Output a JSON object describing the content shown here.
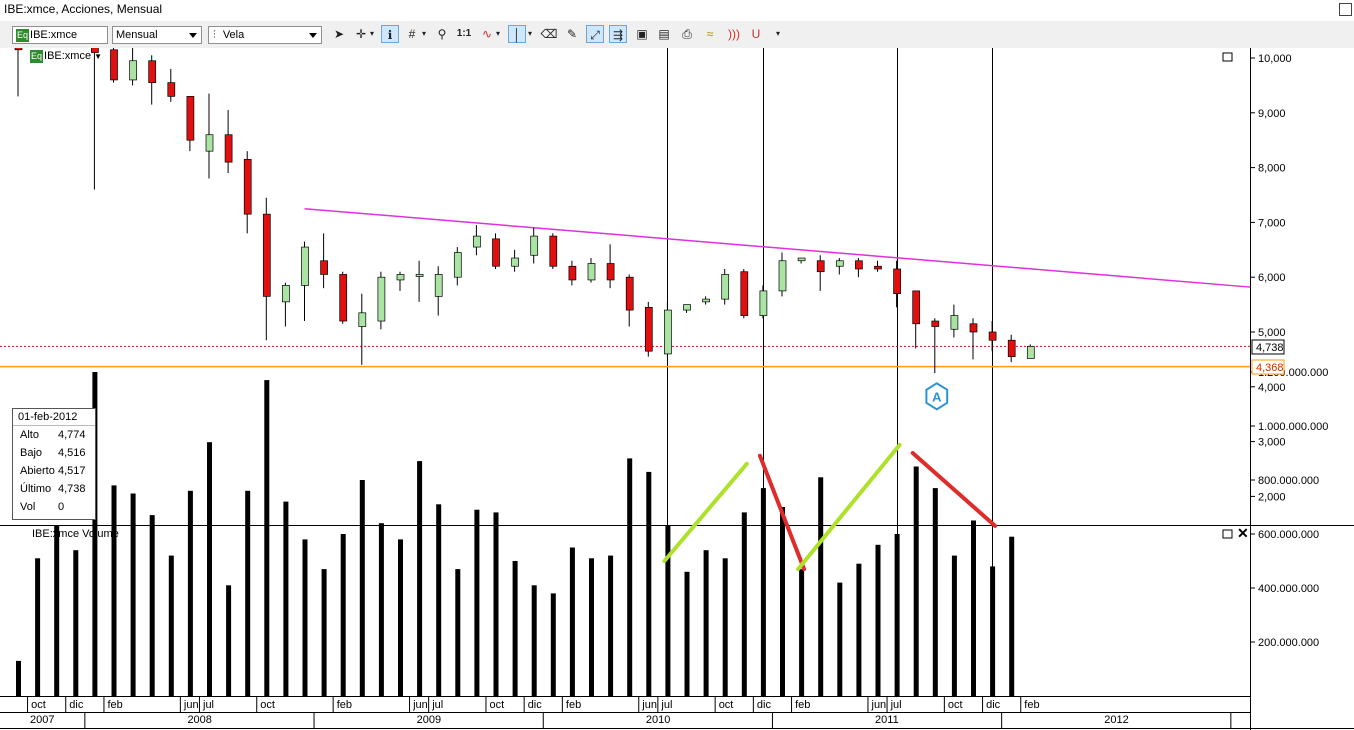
{
  "window": {
    "title": "IBE:xmce, Acciones, Mensual"
  },
  "toolbar": {
    "symbol": "IBE:xmce",
    "symbol_badge": "Eq",
    "period": "Mensual",
    "chart_type": "Vela",
    "zoom_1to1": "1:1"
  },
  "price_panel": {
    "symbol_label": "IBE:xmce",
    "symbol_badge": "Eq",
    "y_ticks": [
      "10,000",
      "9,000",
      "8,000",
      "7,000",
      "6,000",
      "5,000",
      "4,000",
      "3,000",
      "2,000"
    ],
    "current_price_label": "4,738",
    "support_label": "4,368",
    "marker_label": "A"
  },
  "info_box": {
    "date": "01-feb-2012",
    "rows": [
      {
        "label": "Alto",
        "value": "4,774"
      },
      {
        "label": "Bajo",
        "value": "4,516"
      },
      {
        "label": "Abierto",
        "value": "4,517"
      },
      {
        "label": "Último",
        "value": "4,738"
      },
      {
        "label": "Vol",
        "value": "0"
      }
    ]
  },
  "volume_panel": {
    "title": "IBE:xmce Volume",
    "y_ticks": [
      "1.200.000.000",
      "1.000.000.000",
      "800.000.000",
      "600.000.000",
      "400.000.000",
      "200.000.000"
    ]
  },
  "x_axis": {
    "months": [
      "oct",
      "dic",
      "feb",
      "jun",
      "jul",
      "oct",
      "feb",
      "jun",
      "jul",
      "oct",
      "dic",
      "feb",
      "jun",
      "jul",
      "oct",
      "dic",
      "feb",
      "jun",
      "jul",
      "oct",
      "dic",
      "feb"
    ],
    "years": [
      "2007",
      "2008",
      "2009",
      "2010",
      "2011",
      "2012"
    ]
  },
  "colors": {
    "up": "#a9e4a3",
    "down": "#e01010",
    "trendline": "#e030e0",
    "support": "#ff9a1a",
    "current_price": "#e01010",
    "volume_up_trend": "#aee22a",
    "volume_down_trend": "#e02b2b",
    "marker": "#2a93d8"
  },
  "chart_data": {
    "type": "candlestick",
    "period": "monthly",
    "ylim": [
      1500,
      10200
    ],
    "candles": [
      {
        "month": "2007-09",
        "open": 10200,
        "high": 10200,
        "low": 9300,
        "close": 10150
      },
      {
        "month": "2008-01",
        "open": 10200,
        "high": 10200,
        "low": 7600,
        "close": 10100
      },
      {
        "month": "2008-02",
        "open": 10150,
        "high": 10200,
        "low": 9550,
        "close": 9600
      },
      {
        "month": "2008-03",
        "open": 9600,
        "high": 10200,
        "low": 9500,
        "close": 9950
      },
      {
        "month": "2008-04",
        "open": 9950,
        "high": 10050,
        "low": 9150,
        "close": 9550
      },
      {
        "month": "2008-05",
        "open": 9550,
        "high": 9800,
        "low": 9200,
        "close": 9300
      },
      {
        "month": "2008-06",
        "open": 9300,
        "high": 9300,
        "low": 8300,
        "close": 8500
      },
      {
        "month": "2008-07",
        "open": 8300,
        "high": 9350,
        "low": 7800,
        "close": 8600
      },
      {
        "month": "2008-08",
        "open": 8600,
        "high": 9050,
        "low": 7900,
        "close": 8100
      },
      {
        "month": "2008-09",
        "open": 8150,
        "high": 8300,
        "low": 6800,
        "close": 7150
      },
      {
        "month": "2008-10",
        "open": 7150,
        "high": 7450,
        "low": 4850,
        "close": 5650
      },
      {
        "month": "2008-11",
        "open": 5550,
        "high": 5900,
        "low": 5100,
        "close": 5850
      },
      {
        "month": "2008-12",
        "open": 5850,
        "high": 6650,
        "low": 5200,
        "close": 6550
      },
      {
        "month": "2009-01",
        "open": 6300,
        "high": 6800,
        "low": 5800,
        "close": 6050
      },
      {
        "month": "2009-02",
        "open": 6050,
        "high": 6100,
        "low": 5150,
        "close": 5200
      },
      {
        "month": "2009-03",
        "open": 5100,
        "high": 5700,
        "low": 4400,
        "close": 5350
      },
      {
        "month": "2009-04",
        "open": 5200,
        "high": 6100,
        "low": 5050,
        "close": 6000
      },
      {
        "month": "2009-05",
        "open": 5950,
        "high": 6100,
        "low": 5750,
        "close": 6050
      },
      {
        "month": "2009-06",
        "open": 6050,
        "high": 6300,
        "low": 5550,
        "close": 6050
      },
      {
        "month": "2009-07",
        "open": 5650,
        "high": 6200,
        "low": 5300,
        "close": 6050
      },
      {
        "month": "2009-08",
        "open": 6000,
        "high": 6550,
        "low": 5850,
        "close": 6450
      },
      {
        "month": "2009-09",
        "open": 6550,
        "high": 6950,
        "low": 6400,
        "close": 6750
      },
      {
        "month": "2009-10",
        "open": 6700,
        "high": 6800,
        "low": 6150,
        "close": 6200
      },
      {
        "month": "2009-11",
        "open": 6200,
        "high": 6500,
        "low": 6100,
        "close": 6350
      },
      {
        "month": "2009-12",
        "open": 6400,
        "high": 6900,
        "low": 6250,
        "close": 6750
      },
      {
        "month": "2010-01",
        "open": 6750,
        "high": 6800,
        "low": 6150,
        "close": 6200
      },
      {
        "month": "2010-02",
        "open": 6200,
        "high": 6300,
        "low": 5850,
        "close": 5950
      },
      {
        "month": "2010-03",
        "open": 5950,
        "high": 6350,
        "low": 5900,
        "close": 6250
      },
      {
        "month": "2010-04",
        "open": 6250,
        "high": 6600,
        "low": 5800,
        "close": 5950
      },
      {
        "month": "2010-05",
        "open": 6000,
        "high": 6050,
        "low": 5100,
        "close": 5400
      },
      {
        "month": "2010-06",
        "open": 5450,
        "high": 5550,
        "low": 4550,
        "close": 4650
      },
      {
        "month": "2010-07",
        "open": 4600,
        "high": 5550,
        "low": 4550,
        "close": 5400
      },
      {
        "month": "2010-08",
        "open": 5400,
        "high": 5500,
        "low": 5350,
        "close": 5500
      },
      {
        "month": "2010-09",
        "open": 5550,
        "high": 5650,
        "low": 5500,
        "close": 5600
      },
      {
        "month": "2010-10",
        "open": 5600,
        "high": 6150,
        "low": 5500,
        "close": 6050
      },
      {
        "month": "2010-11",
        "open": 6100,
        "high": 6150,
        "low": 5250,
        "close": 5300
      },
      {
        "month": "2010-12",
        "open": 5300,
        "high": 5850,
        "low": 5250,
        "close": 5750
      },
      {
        "month": "2011-01",
        "open": 5750,
        "high": 6450,
        "low": 5650,
        "close": 6300
      },
      {
        "month": "2011-02",
        "open": 6300,
        "high": 6350,
        "low": 6250,
        "close": 6350
      },
      {
        "month": "2011-03",
        "open": 6300,
        "high": 6400,
        "low": 5750,
        "close": 6100
      },
      {
        "month": "2011-04",
        "open": 6200,
        "high": 6350,
        "low": 6050,
        "close": 6300
      },
      {
        "month": "2011-05",
        "open": 6300,
        "high": 6350,
        "low": 6000,
        "close": 6150
      },
      {
        "month": "2011-06",
        "open": 6200,
        "high": 6300,
        "low": 6100,
        "close": 6150
      },
      {
        "month": "2011-07",
        "open": 6150,
        "high": 6300,
        "low": 5450,
        "close": 5700
      },
      {
        "month": "2011-08",
        "open": 5750,
        "high": 5750,
        "low": 4700,
        "close": 5150
      },
      {
        "month": "2011-09",
        "open": 5200,
        "high": 5250,
        "low": 4250,
        "close": 5100
      },
      {
        "month": "2011-10",
        "open": 5050,
        "high": 5500,
        "low": 4900,
        "close": 5300
      },
      {
        "month": "2011-11",
        "open": 5150,
        "high": 5250,
        "low": 4500,
        "close": 5000
      },
      {
        "month": "2011-12",
        "open": 5000,
        "high": 5200,
        "low": 4650,
        "close": 4850
      },
      {
        "month": "2012-01",
        "open": 4850,
        "high": 4950,
        "low": 4450,
        "close": 4550
      },
      {
        "month": "2012-02",
        "open": 4517,
        "high": 4774,
        "low": 4516,
        "close": 4738
      }
    ],
    "volume": [
      {
        "month": "2007-09",
        "value": 130000000
      },
      {
        "month": "2007-10",
        "value": 510000000
      },
      {
        "month": "2007-11",
        "value": 630000000
      },
      {
        "month": "2007-12",
        "value": 540000000
      },
      {
        "month": "2008-01",
        "value": 1200000000
      },
      {
        "month": "2008-02",
        "value": 780000000
      },
      {
        "month": "2008-03",
        "value": 750000000
      },
      {
        "month": "2008-04",
        "value": 670000000
      },
      {
        "month": "2008-05",
        "value": 520000000
      },
      {
        "month": "2008-06",
        "value": 760000000
      },
      {
        "month": "2008-07",
        "value": 940000000
      },
      {
        "month": "2008-08",
        "value": 410000000
      },
      {
        "month": "2008-09",
        "value": 760000000
      },
      {
        "month": "2008-10",
        "value": 1170000000
      },
      {
        "month": "2008-11",
        "value": 720000000
      },
      {
        "month": "2008-12",
        "value": 580000000
      },
      {
        "month": "2009-01",
        "value": 470000000
      },
      {
        "month": "2009-02",
        "value": 600000000
      },
      {
        "month": "2009-03",
        "value": 800000000
      },
      {
        "month": "2009-04",
        "value": 640000000
      },
      {
        "month": "2009-05",
        "value": 580000000
      },
      {
        "month": "2009-06",
        "value": 870000000
      },
      {
        "month": "2009-07",
        "value": 710000000
      },
      {
        "month": "2009-08",
        "value": 470000000
      },
      {
        "month": "2009-09",
        "value": 690000000
      },
      {
        "month": "2009-10",
        "value": 680000000
      },
      {
        "month": "2009-11",
        "value": 500000000
      },
      {
        "month": "2009-12",
        "value": 410000000
      },
      {
        "month": "2010-01",
        "value": 380000000
      },
      {
        "month": "2010-02",
        "value": 550000000
      },
      {
        "month": "2010-03",
        "value": 510000000
      },
      {
        "month": "2010-04",
        "value": 520000000
      },
      {
        "month": "2010-05",
        "value": 880000000
      },
      {
        "month": "2010-06",
        "value": 830000000
      },
      {
        "month": "2010-07",
        "value": 630000000
      },
      {
        "month": "2010-08",
        "value": 460000000
      },
      {
        "month": "2010-09",
        "value": 540000000
      },
      {
        "month": "2010-10",
        "value": 510000000
      },
      {
        "month": "2010-11",
        "value": 680000000
      },
      {
        "month": "2010-12",
        "value": 770000000
      },
      {
        "month": "2011-01",
        "value": 700000000
      },
      {
        "month": "2011-02",
        "value": 470000000
      },
      {
        "month": "2011-03",
        "value": 810000000
      },
      {
        "month": "2011-04",
        "value": 420000000
      },
      {
        "month": "2011-05",
        "value": 490000000
      },
      {
        "month": "2011-06",
        "value": 560000000
      },
      {
        "month": "2011-07",
        "value": 600000000
      },
      {
        "month": "2011-08",
        "value": 850000000
      },
      {
        "month": "2011-09",
        "value": 770000000
      },
      {
        "month": "2011-10",
        "value": 520000000
      },
      {
        "month": "2011-11",
        "value": 650000000
      },
      {
        "month": "2011-12",
        "value": 480000000
      },
      {
        "month": "2012-01",
        "value": 590000000
      }
    ],
    "volume_ylim": [
      0,
      1250000000
    ],
    "resistance_trendline": {
      "start": {
        "month": "2008-12",
        "price": 7250
      },
      "end": {
        "month": "2012-10",
        "price": 5820
      }
    },
    "support_level": 4368,
    "current_price": 4738,
    "vertical_lines": [
      "2010-07",
      "2010-12",
      "2011-07",
      "2011-12"
    ],
    "marker": {
      "month": "2011-09",
      "price": 3900
    },
    "volume_trendlines": [
      {
        "start": {
          "month": "2010-07",
          "value": 500000000
        },
        "end": {
          "month": "2010-11",
          "value": 860000000
        },
        "color": "green"
      },
      {
        "start": {
          "month": "2010-12",
          "value": 890000000
        },
        "end": {
          "month": "2011-02",
          "value": 470000000
        },
        "color": "red"
      },
      {
        "start": {
          "month": "2011-02",
          "value": 470000000
        },
        "end": {
          "month": "2011-07",
          "value": 930000000
        },
        "color": "green"
      },
      {
        "start": {
          "month": "2011-08",
          "value": 900000000
        },
        "end": {
          "month": "2011-12",
          "value": 630000000
        },
        "color": "red"
      }
    ]
  }
}
